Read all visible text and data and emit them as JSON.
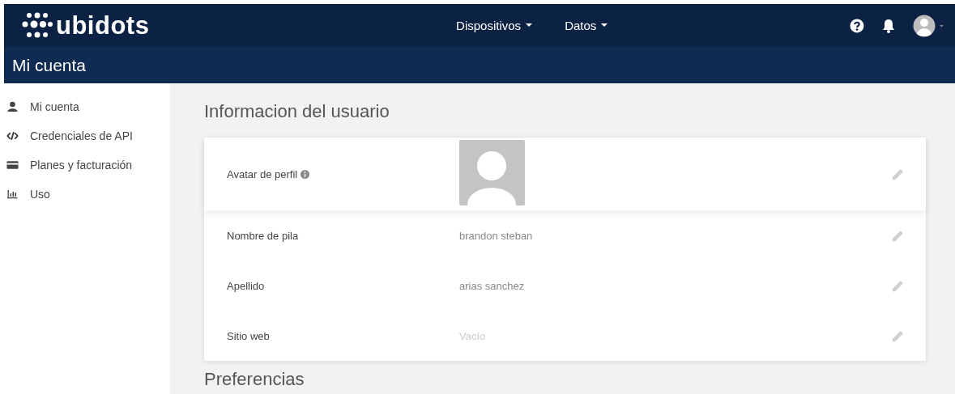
{
  "navbar": {
    "logo": "ubidots",
    "menus": [
      {
        "label": "Dispositivos"
      },
      {
        "label": "Datos"
      }
    ]
  },
  "subheader": {
    "title": "Mi cuenta"
  },
  "sidebar": {
    "items": [
      {
        "label": "Mi cuenta",
        "kind": "user"
      },
      {
        "label": "Credenciales de API",
        "kind": "code"
      },
      {
        "label": "Planes y facturación",
        "kind": "card"
      },
      {
        "label": "Uso",
        "kind": "chart"
      }
    ]
  },
  "section_title": "Informacion del usuario",
  "fields": [
    {
      "kind": "avatar",
      "label": "Avatar de perfil"
    },
    {
      "kind": "text",
      "label": "Nombre de pila",
      "value": "brandon steban",
      "empty": false
    },
    {
      "kind": "text",
      "label": "Apellido",
      "value": "arias sanchez",
      "empty": false
    },
    {
      "kind": "text",
      "label": "Sitio web",
      "value": "Vacío",
      "empty": true
    }
  ],
  "next_section_title": "Preferencias"
}
